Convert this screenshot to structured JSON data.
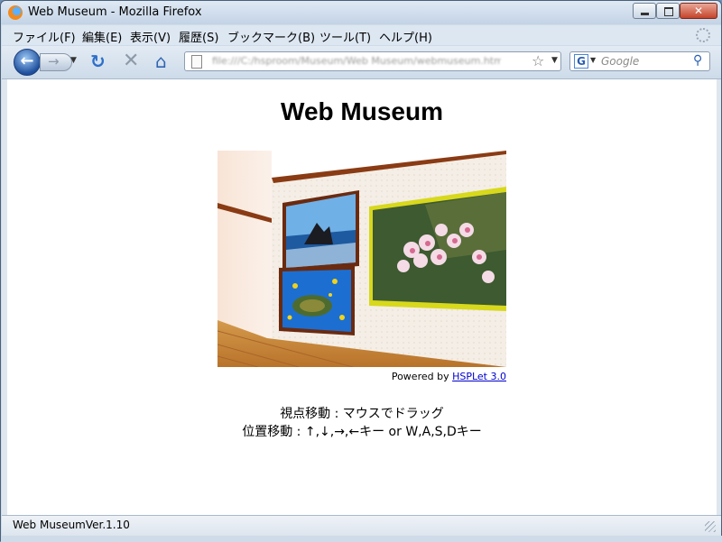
{
  "window": {
    "title": "Web Museum - Mozilla Firefox"
  },
  "menu": {
    "items": [
      {
        "label": "ファイル(F)"
      },
      {
        "label": "編集(E)"
      },
      {
        "label": "表示(V)"
      },
      {
        "label": "履歴(S)"
      },
      {
        "label": "ブックマーク(B)"
      },
      {
        "label": "ツール(T)"
      },
      {
        "label": "ヘルプ(H)"
      }
    ]
  },
  "nav": {
    "back_glyph": "←",
    "forward_glyph": "→",
    "reload_glyph": "↻",
    "stop_glyph": "✕",
    "home_glyph": "⌂",
    "url": "file:///C:/hsproom/Museum/Web Museum/webmuseum.htm",
    "search_engine": "G",
    "search_placeholder": "Google"
  },
  "page": {
    "title": "Web Museum",
    "powered_by": "Powered by ",
    "powered_link": "HSPLet 3.0",
    "instruction_view": "視点移動 : マウスでドラッグ",
    "instruction_move": "位置移動 : ↑,↓,→,←キー or W,A,S,Dキー"
  },
  "status": {
    "text": "Web MuseumVer.1.10"
  },
  "colors": {
    "accent": "#2f64b3",
    "link": "#0000cc",
    "chrome": "#cfdbe8",
    "gallery_floor": "#c98a3a",
    "gallery_wall": "#f3ece4"
  }
}
